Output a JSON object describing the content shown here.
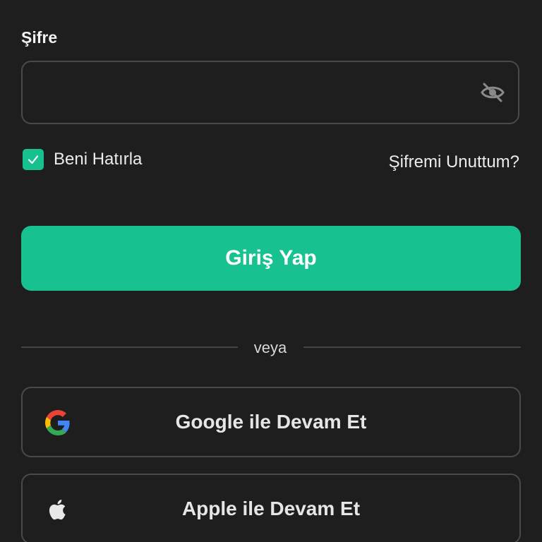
{
  "password": {
    "label": "Şifre",
    "value": "",
    "placeholder": "",
    "visibility_icon": "eye-off-icon"
  },
  "remember_me": {
    "label": "Beni Hatırla",
    "checked": true
  },
  "forgot_password": {
    "label": "Şifremi Unuttum?"
  },
  "login_button": {
    "label": "Giriş Yap"
  },
  "divider": {
    "label": "veya"
  },
  "social": {
    "google": {
      "label": "Google ile Devam Et",
      "icon": "google-icon"
    },
    "apple": {
      "label": "Apple ile Devam Et",
      "icon": "apple-icon"
    }
  },
  "colors": {
    "background": "#1e1e1e",
    "accent": "#17c290",
    "border": "#4a4a4a",
    "text": "#f2f2f2"
  }
}
